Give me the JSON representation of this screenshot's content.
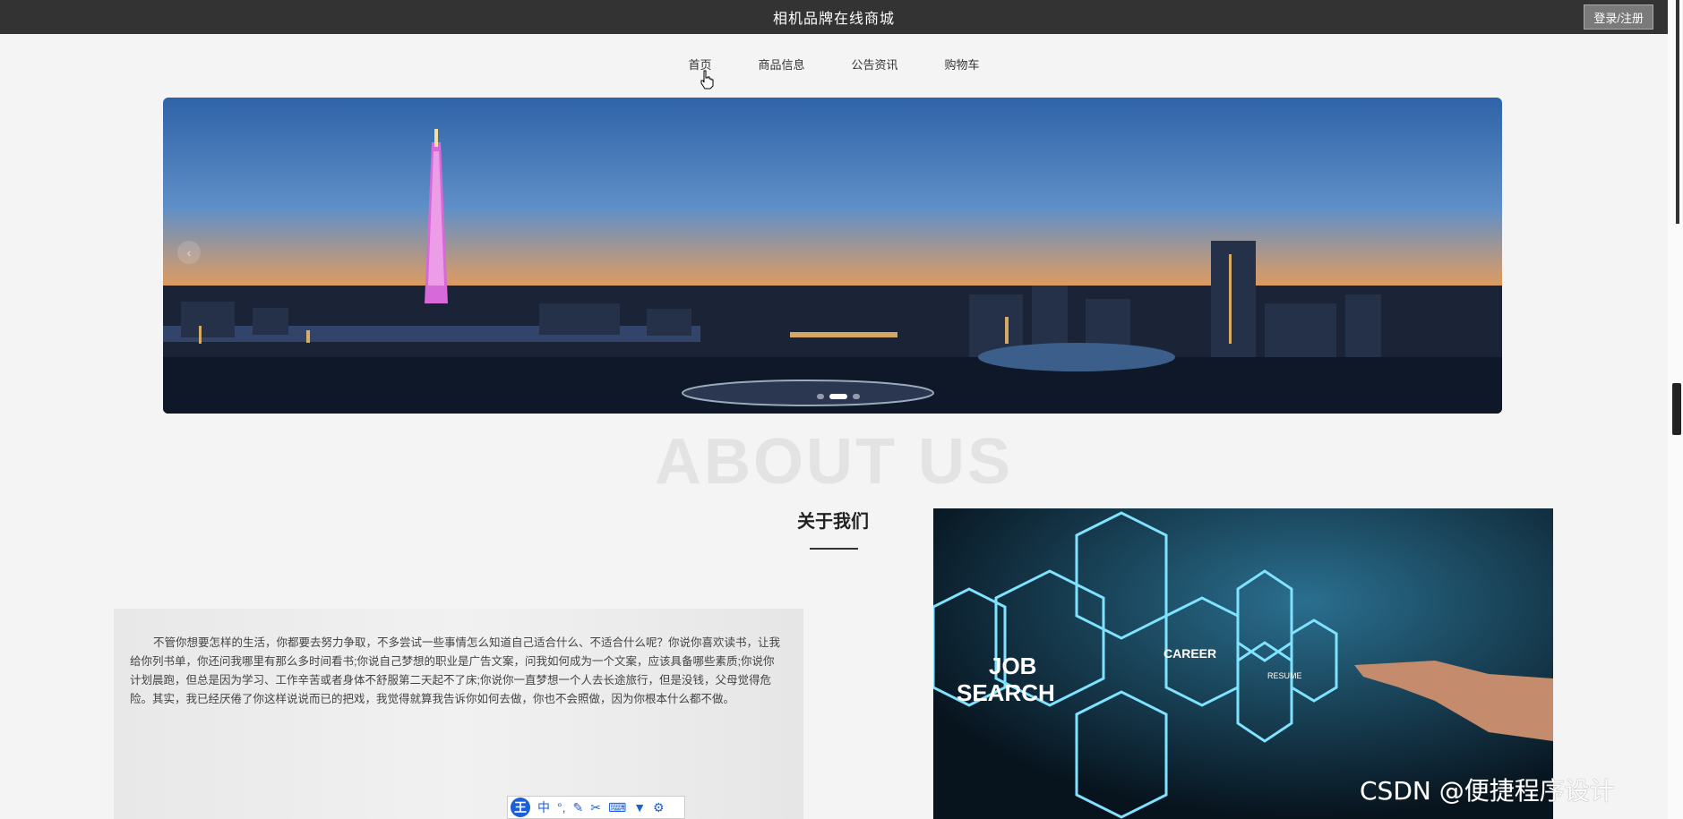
{
  "header": {
    "title": "相机品牌在线商城",
    "login_label": "登录/注册"
  },
  "nav": {
    "items": [
      {
        "label": "首页"
      },
      {
        "label": "商品信息"
      },
      {
        "label": "公告资讯"
      },
      {
        "label": "购物车"
      }
    ]
  },
  "banner": {
    "prev_symbol": "‹",
    "slides": 3,
    "active_slide": 2
  },
  "about": {
    "watermark": "ABOUT US",
    "title": "关于我们",
    "body": "不管你想要怎样的生活，你都要去努力争取，不多尝试一些事情怎么知道自己适合什么、不适合什么呢？你说你喜欢读书，让我给你列书单，你还问我哪里有那么多时间看书;你说自己梦想的职业是广告文案，问我如何成为一个文案，应该具备哪些素质;你说你计划晨跑，但总是因为学习、工作辛苦或者身体不舒服第二天起不了床;你说你一直梦想一个人去长途旅行，但是没钱，父母觉得危险。其实，我已经厌倦了你这样说说而已的把戏，我觉得就算我告诉你如何去做，你也不会照做，因为你根本什么都不做。",
    "image_texts": [
      "JOB",
      "SEARCH",
      "CAREER",
      "RESUME"
    ]
  },
  "ime": {
    "logo": "王",
    "mode": "中"
  },
  "watermark_text": "CSDN @便捷程序设计"
}
